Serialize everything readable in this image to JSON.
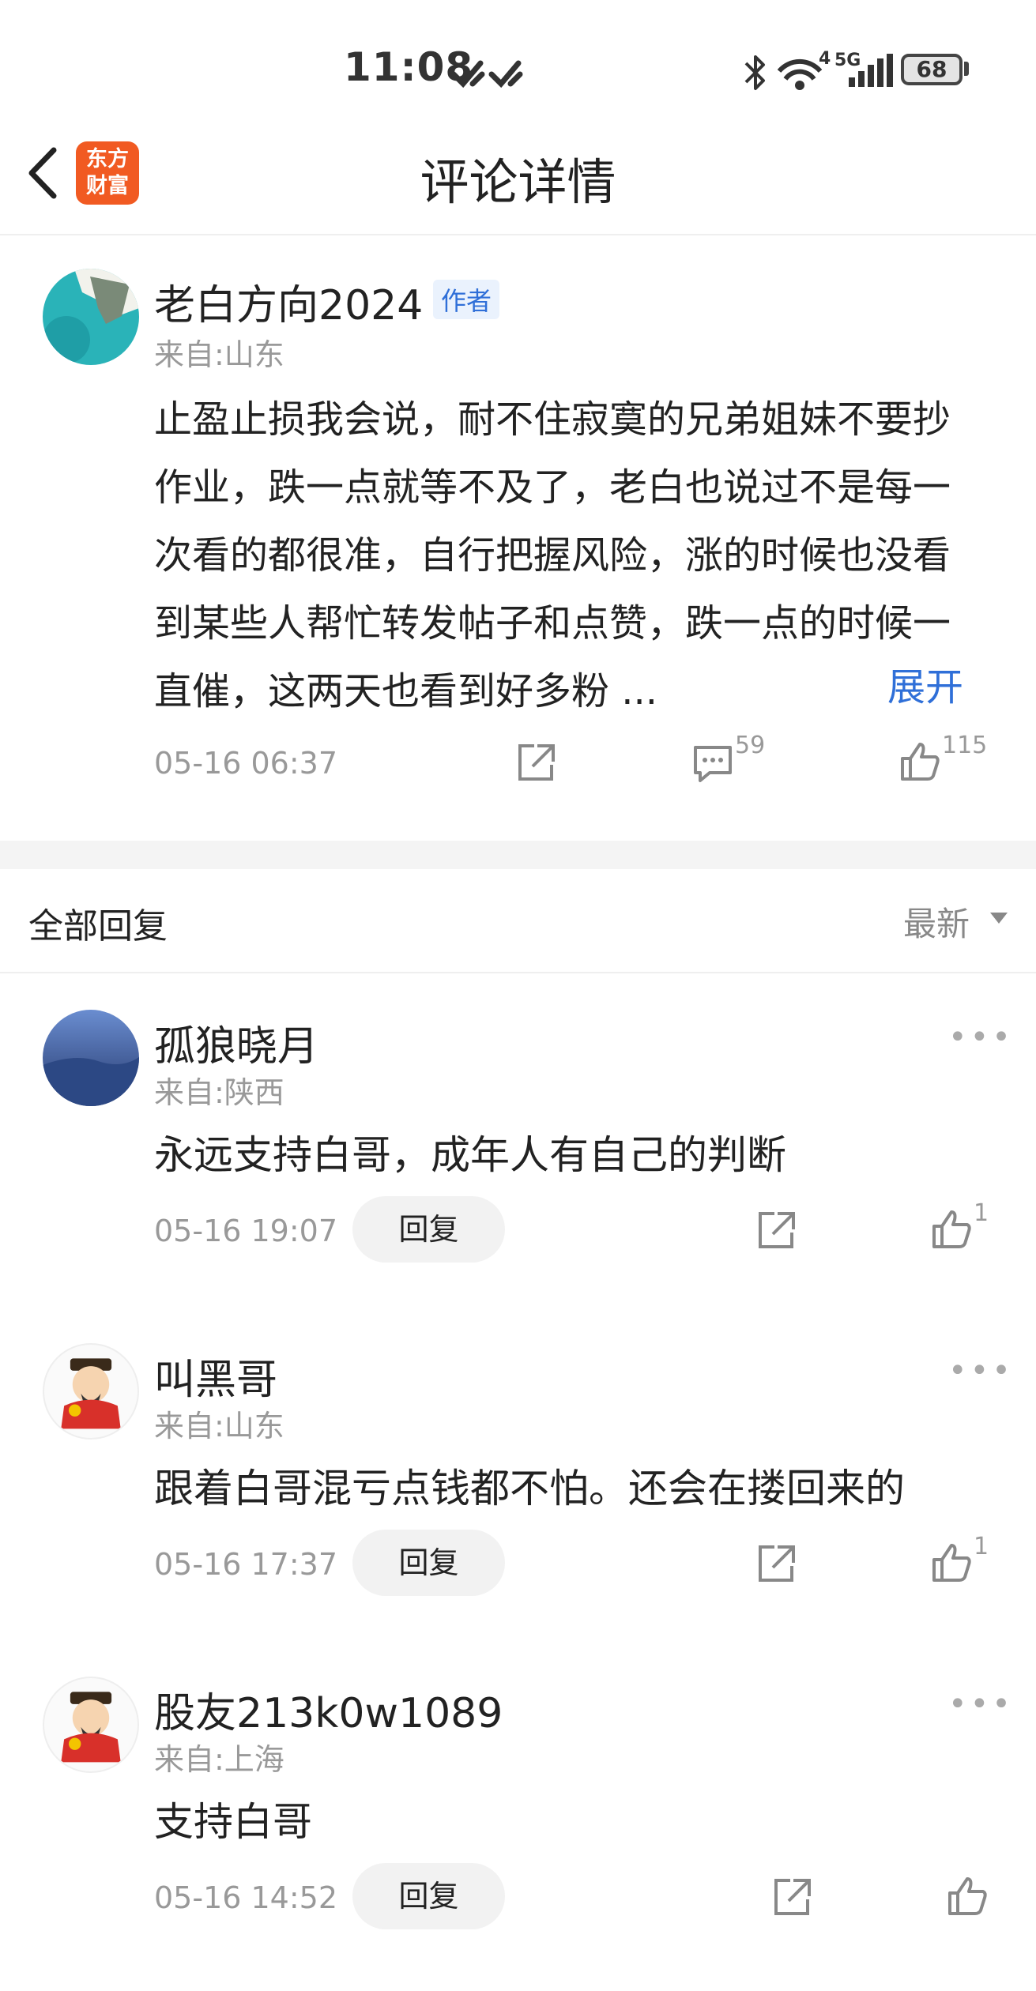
{
  "status_bar": {
    "time": "11:08",
    "network_label": "4",
    "network_gen": "5G",
    "battery": "68"
  },
  "header": {
    "logo_line1": "东方",
    "logo_line2": "财富",
    "title": "评论详情"
  },
  "main_comment": {
    "author": "老白方向2024",
    "author_tag": "作者",
    "location": "来自:山东",
    "text": "止盈止损我会说，耐不住寂寞的兄弟姐妹不要抄作业，跌一点就等不及了，老白也说过不是每一次看的都很准，自行把握风险，涨的时候也没看到某些人帮忙转发帖子和点赞，跌一点的时候一直催，这两天也看到好多粉 ...",
    "expand_label": "展开",
    "time": "05-16 06:37",
    "comment_count": "59",
    "like_count": "115"
  },
  "replies_section": {
    "title": "全部回复",
    "sort_label": "最新"
  },
  "replies": [
    {
      "author": "孤狼晓月",
      "location": "来自:陕西",
      "text": "永远支持白哥，成年人有自己的判断",
      "time": "05-16 19:07",
      "reply_label": "回复",
      "like_count": "1"
    },
    {
      "author": "叫黑哥",
      "location": "来自:山东",
      "text": "跟着白哥混亏点钱都不怕。还会在搂回来的",
      "time": "05-16 17:37",
      "reply_label": "回复",
      "like_count": "1"
    },
    {
      "author": "股友213k0w1089",
      "location": "来自:上海",
      "text": "支持白哥",
      "time": "05-16 14:52",
      "reply_label": "回复",
      "like_count": ""
    }
  ],
  "colors": {
    "brand": "#f15a22",
    "link": "#2f6fd8",
    "muted": "#999999"
  }
}
